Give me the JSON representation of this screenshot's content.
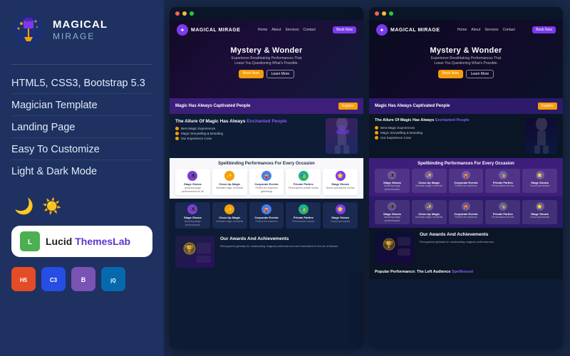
{
  "app": {
    "logo_title": "MAGICAL",
    "logo_sub": "MIRAGE"
  },
  "left": {
    "features": [
      {
        "label": "HTML5, CSS3, Bootstrap 5.3"
      },
      {
        "label": "Magician Template"
      },
      {
        "label": "Landing Page"
      },
      {
        "label": "Easy To Customize"
      },
      {
        "label": "Light & Dark Mode"
      }
    ],
    "badge_text": "Lucid ThemesLab",
    "tech": [
      {
        "label": "H5",
        "class": "tech-html"
      },
      {
        "label": "C3",
        "class": "tech-css"
      },
      {
        "label": "B",
        "class": "tech-bs"
      },
      {
        "label": "jQ",
        "class": "tech-jq"
      }
    ]
  },
  "preview": {
    "hero_title": "Mystery & Wonder",
    "hero_sub": "Experience Breathtaking Performances That\nLeave You Questioning What's Possible.",
    "hero_cta": "Book Now",
    "hero_ghost": "Learn More",
    "purple_title": "Magic Has Always Captivated People",
    "purple_btn": "Explore",
    "allure_title": "The Allure Of Magic Has Always",
    "allure_title_accent": "Enchanted People",
    "allure_items": [
      "Best Magic Experiences",
      "Magic Storytelling & Branding",
      "Our Experience Crew"
    ],
    "cards_title": "Spellbinding Performances For Every Occasion",
    "cards": [
      {
        "icon": "🎩",
        "title": "Stage Shows",
        "desc": "Amazing stage performances",
        "color": ""
      },
      {
        "icon": "✨",
        "title": "Close-Up Magic",
        "desc": "Intimate magic moments",
        "color": "orange"
      },
      {
        "icon": "🎪",
        "title": "Corporate Events",
        "desc": "Perfect for business",
        "color": "blue"
      },
      {
        "icon": "🎭",
        "title": "Private Parties",
        "desc": "Personalized shows",
        "color": "green"
      },
      {
        "icon": "🌟",
        "title": "Stage Shows",
        "desc": "Grand spectacles",
        "color": ""
      }
    ],
    "awards_title": "Our Awards And Achievements",
    "awards_desc": "Recognized globally for outstanding magical performances and innovation in the art of illusion."
  }
}
